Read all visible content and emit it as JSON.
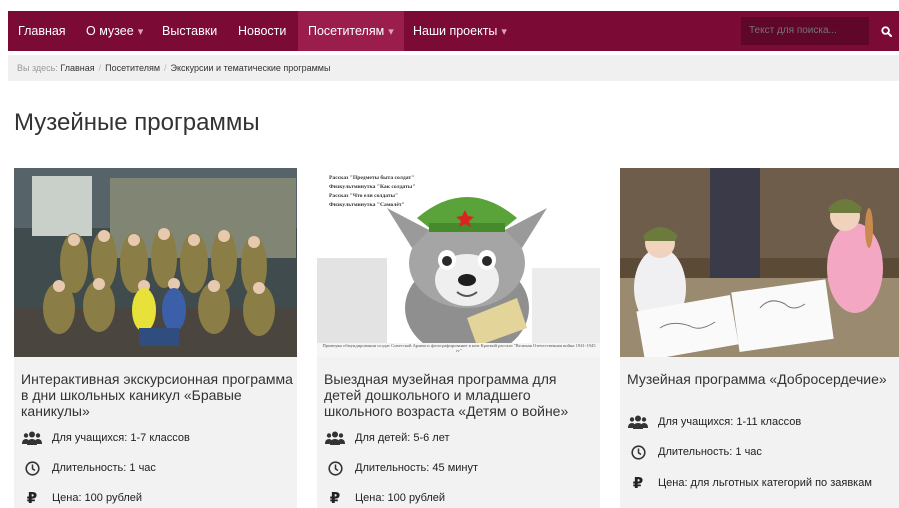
{
  "nav": {
    "items": [
      {
        "label": "Главная",
        "caret": ""
      },
      {
        "label": "О музее",
        "caret": "▾"
      },
      {
        "label": "Выставки",
        "caret": ""
      },
      {
        "label": "Новости",
        "caret": ""
      },
      {
        "label": "Посетителям",
        "caret": "▾"
      },
      {
        "label": "Наши проекты",
        "caret": "▾"
      }
    ],
    "search_placeholder": "Текст для поиска...",
    "colors": {
      "bar": "#7b0b35",
      "active": "#9b1d4c",
      "search_bg": "#5f0729"
    }
  },
  "breadcrumb": {
    "prefix": "Вы здесь:",
    "items": [
      "Главная",
      "Посетителям",
      "Экскурсии и тематические программы"
    ]
  },
  "page_title": "Музейные программы",
  "cards": [
    {
      "title": "Интерактивная экскурсионная программа в дни школьных каникул «Бравые каникулы»",
      "audience": "Для учащихся: 1-7 классов",
      "duration": "Длительность: 1 час",
      "price": "Цена: 100 рублей",
      "image": "group-photo-soldiers-costumes"
    },
    {
      "title": "Выездная музейная программа для детей дошкольного и младшего школьного возраста «Детям о войне»",
      "audience": "Для детей: 5-6 лет",
      "duration": "Длительность: 45 минут",
      "price": "Цена: 100 рублей",
      "image": "cartoon-dog-soldier-cap",
      "image_text": {
        "lines": [
          "Рассказ \"Предметы быта солдат\"",
          "Физкультминутка \"Как солдаты\"",
          "Рассказ \"Что ели солдаты\"",
          "Физкультминутка \"Самолёт\""
        ],
        "caption": "Примерка обмундирования солдат Советской Армии и фотографирование в нем Краткий рассказ \"Великая Отечественная война 1941-1945 гг\""
      }
    },
    {
      "title": "Музейная программа «Добросердечие»",
      "audience": "Для учащихся: 1-11 классов",
      "duration": "Длительность: 1 час",
      "price": "Цена: для льготных категорий по заявкам",
      "image": "children-drawing-table"
    }
  ],
  "icons": {
    "audience": "users-icon",
    "duration": "clock-icon",
    "price": "ruble-icon",
    "search": "search-icon"
  }
}
